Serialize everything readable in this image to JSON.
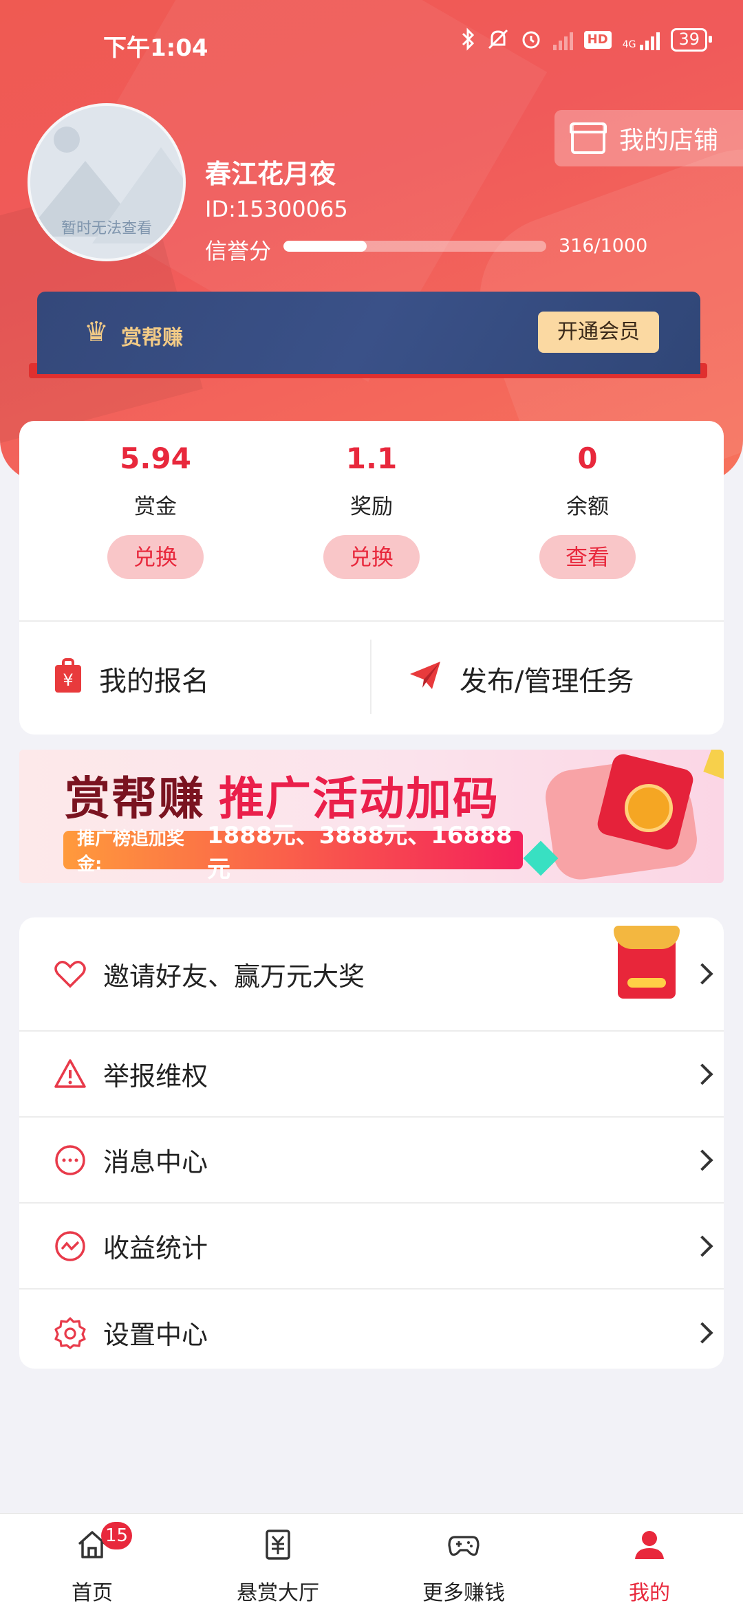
{
  "status_bar": {
    "time": "下午1:04",
    "battery": "39",
    "network": "4G",
    "hd_label": "HD"
  },
  "profile": {
    "avatar_caption": "暂时无法查看",
    "name": "春江花月夜",
    "id": "ID:15300065",
    "credit_label": "信誉分",
    "credit_value": "316/1000",
    "credit_fraction": 0.316,
    "shop_button": "我的店铺"
  },
  "vip": {
    "label": "赏帮赚",
    "button": "开通会员"
  },
  "stats": [
    {
      "value": "5.94",
      "label": "赏金",
      "button": "兑换"
    },
    {
      "value": "1.1",
      "label": "奖励",
      "button": "兑换"
    },
    {
      "value": "0",
      "label": "余额",
      "button": "查看"
    }
  ],
  "actions": {
    "my_signup": "我的报名",
    "publish_manage": "发布/管理任务"
  },
  "promo": {
    "title_brand": "赏帮赚",
    "title_rest": "推广活动加码",
    "bonus_label": "推广榜追加奖金:",
    "bonus_values": "1888元、3888元、16888元"
  },
  "menu": [
    {
      "label": "邀请好友、赢万元大奖",
      "icon": "heart-icon"
    },
    {
      "label": "举报维权",
      "icon": "warning-icon"
    },
    {
      "label": "消息中心",
      "icon": "message-icon"
    },
    {
      "label": "收益统计",
      "icon": "stats-icon"
    },
    {
      "label": "设置中心",
      "icon": "gear-icon"
    }
  ],
  "nav": [
    {
      "label": "首页",
      "badge": "15",
      "icon": "home-icon"
    },
    {
      "label": "悬赏大厅",
      "icon": "yuan-doc-icon"
    },
    {
      "label": "更多赚钱",
      "icon": "gamepad-icon"
    },
    {
      "label": "我的",
      "icon": "user-icon",
      "active": true
    }
  ],
  "colors": {
    "primary": "#e8283c",
    "hero": "#ef5a52",
    "vip_bg": "#34487a",
    "vip_gold": "#f3cb86"
  }
}
